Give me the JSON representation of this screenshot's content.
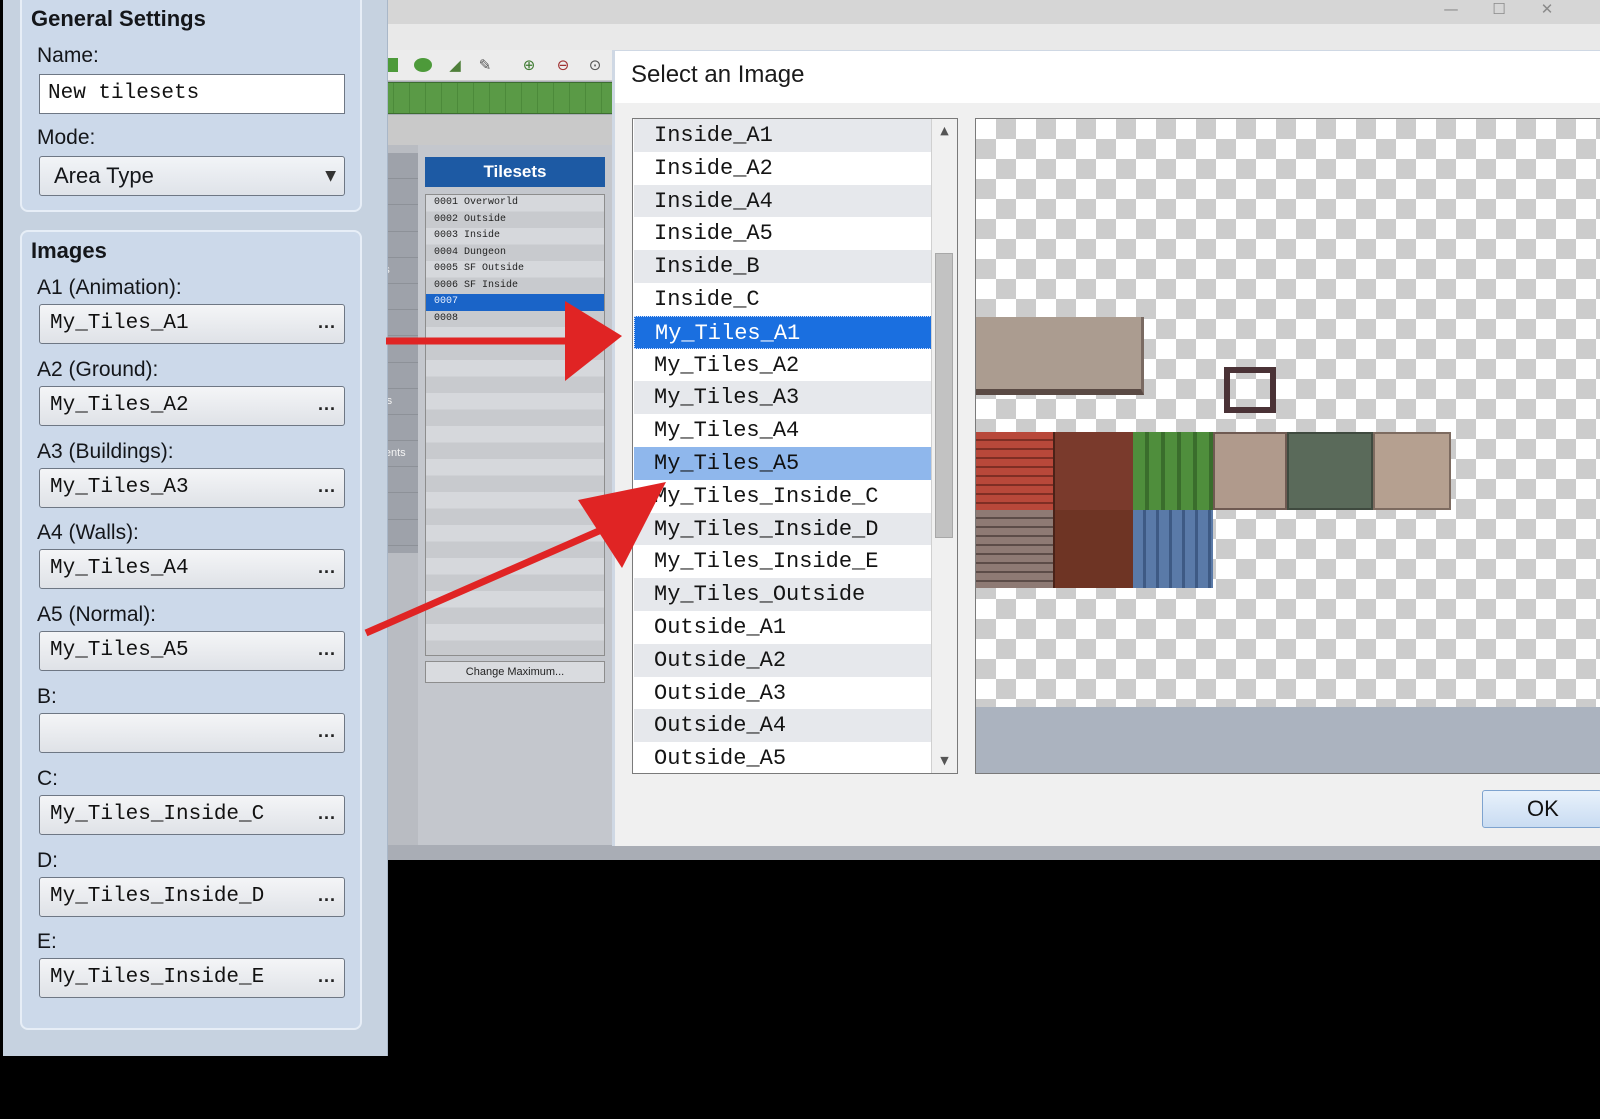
{
  "settings": {
    "general_title": "General Settings",
    "name_label": "Name:",
    "name_value": "New tilesets",
    "mode_label": "Mode:",
    "mode_value": "Area Type",
    "images_title": "Images",
    "image_fields": [
      {
        "label": "A1 (Animation):",
        "value": "My_Tiles_A1"
      },
      {
        "label": "A2 (Ground):",
        "value": "My_Tiles_A2"
      },
      {
        "label": "A3 (Buildings):",
        "value": "My_Tiles_A3"
      },
      {
        "label": "A4 (Walls):",
        "value": "My_Tiles_A4"
      },
      {
        "label": "A5 (Normal):",
        "value": "My_Tiles_A5"
      },
      {
        "label": "B:",
        "value": ""
      },
      {
        "label": "C:",
        "value": "My_Tiles_Inside_C"
      },
      {
        "label": "D:",
        "value": "My_Tiles_Inside_D"
      },
      {
        "label": "E:",
        "value": "My_Tiles_Inside_E"
      }
    ],
    "browse_label": "..."
  },
  "background_editor": {
    "window_controls": [
      "—",
      "☐",
      "✕"
    ],
    "categories": [
      "rs",
      "es",
      "s",
      "s",
      "ons",
      "rs",
      "es",
      "os",
      "s",
      "ions",
      "ts",
      "Events",
      "m",
      "s",
      "s"
    ],
    "tilesets_header": "Tilesets",
    "tilesets": [
      "0001 Overworld",
      "0002 Outside",
      "0003 Inside",
      "0004 Dungeon",
      "0005 SF Outside",
      "0006 SF Inside",
      "0007",
      "0008"
    ],
    "change_maximum_label": "Change Maximum..."
  },
  "dialog": {
    "title": "Select an Image",
    "files": [
      "Inside_A1",
      "Inside_A2",
      "Inside_A4",
      "Inside_A5",
      "Inside_B",
      "Inside_C",
      "My_Tiles_A1",
      "My_Tiles_A2",
      "My_Tiles_A3",
      "My_Tiles_A4",
      "My_Tiles_A5",
      "My_Tiles_Inside_C",
      "My_Tiles_Inside_D",
      "My_Tiles_Inside_E",
      "My_Tiles_Outside",
      "Outside_A1",
      "Outside_A2",
      "Outside_A3",
      "Outside_A4",
      "Outside_A5"
    ],
    "ok_label": "OK"
  },
  "colors": {
    "arrow": "#e02424",
    "selection_primary": "#1a6fe0",
    "selection_secondary": "#8fb7ec",
    "tileset_header": "#1d5aa4"
  }
}
